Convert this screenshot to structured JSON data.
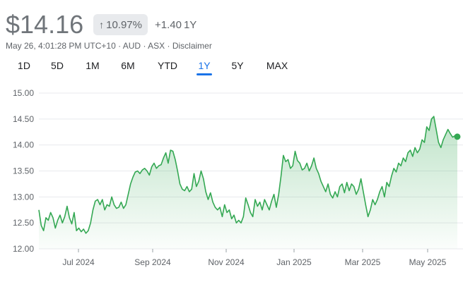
{
  "quote": {
    "price": "$14.16",
    "change_percent": "10.97%",
    "change_abs": "+1.40",
    "change_period": "1Y",
    "arrow_icon": "arrow-up-icon"
  },
  "meta": {
    "timestamp": "May 26, 4:01:28 PM UTC+10",
    "currency": "AUD",
    "exchange": "ASX",
    "disclaimer": "Disclaimer",
    "sep": "·"
  },
  "tabs": [
    {
      "label": "1D",
      "active": false
    },
    {
      "label": "5D",
      "active": false
    },
    {
      "label": "1M",
      "active": false
    },
    {
      "label": "6M",
      "active": false
    },
    {
      "label": "YTD",
      "active": false
    },
    {
      "label": "1Y",
      "active": true
    },
    {
      "label": "5Y",
      "active": false
    },
    {
      "label": "MAX",
      "active": false
    }
  ],
  "colors": {
    "line": "#34a853",
    "fill_top": "#34a853",
    "grid": "#e8eaed",
    "accent": "#1a73e8"
  },
  "chart_data": {
    "type": "area",
    "ylim": [
      12.0,
      15.0
    ],
    "y_ticks": [
      "12.00",
      "12.50",
      "13.00",
      "13.50",
      "14.00",
      "14.50",
      "15.00"
    ],
    "x_ticks": [
      "Jul 2024",
      "Sep 2024",
      "Nov 2024",
      "Jan 2025",
      "Mar 2025",
      "May 2025"
    ],
    "grid": true,
    "series": [
      {
        "values": [
          12.75,
          12.45,
          12.35,
          12.6,
          12.55,
          12.7,
          12.6,
          12.4,
          12.55,
          12.65,
          12.5,
          12.62,
          12.82,
          12.6,
          12.48,
          12.7,
          12.35,
          12.4,
          12.33,
          12.38,
          12.3,
          12.35,
          12.5,
          12.75,
          12.92,
          12.95,
          12.85,
          12.95,
          12.75,
          12.85,
          12.82,
          13.0,
          12.85,
          12.78,
          12.8,
          12.9,
          12.78,
          12.85,
          13.05,
          13.25,
          13.38,
          13.48,
          13.5,
          13.45,
          13.52,
          13.55,
          13.5,
          13.42,
          13.58,
          13.65,
          13.55,
          13.6,
          13.62,
          13.75,
          13.85,
          13.65,
          13.9,
          13.88,
          13.72,
          13.5,
          13.25,
          13.15,
          13.12,
          13.2,
          13.1,
          13.15,
          13.45,
          13.2,
          13.3,
          13.5,
          13.35,
          13.1,
          12.95,
          13.08,
          12.9,
          12.8,
          12.75,
          12.8,
          12.62,
          12.85,
          12.7,
          12.75,
          12.58,
          12.65,
          12.5,
          12.55,
          12.5,
          12.62,
          12.98,
          12.85,
          12.7,
          12.62,
          12.95,
          12.82,
          12.9,
          12.75,
          12.95,
          12.85,
          12.75,
          12.92,
          13.05,
          12.8,
          13.05,
          13.4,
          13.8,
          13.68,
          13.72,
          13.55,
          13.6,
          13.88,
          13.7,
          13.65,
          13.52,
          13.55,
          13.65,
          13.5,
          13.6,
          13.75,
          13.55,
          13.45,
          13.3,
          13.2,
          13.1,
          13.25,
          13.05,
          12.98,
          13.1,
          13.0,
          13.2,
          13.25,
          13.08,
          13.28,
          13.12,
          13.25,
          13.2,
          13.05,
          13.15,
          13.35,
          13.1,
          12.85,
          12.62,
          12.75,
          12.95,
          12.85,
          12.95,
          13.1,
          13.2,
          13.0,
          13.28,
          13.2,
          13.4,
          13.55,
          13.48,
          13.65,
          13.6,
          13.75,
          13.68,
          13.85,
          13.9,
          13.78,
          13.95,
          13.85,
          13.92,
          14.1,
          14.05,
          14.35,
          14.28,
          14.5,
          14.55,
          14.3,
          14.05,
          13.95,
          14.1,
          14.2,
          14.3,
          14.22,
          14.15,
          14.18,
          14.16
        ]
      }
    ]
  }
}
